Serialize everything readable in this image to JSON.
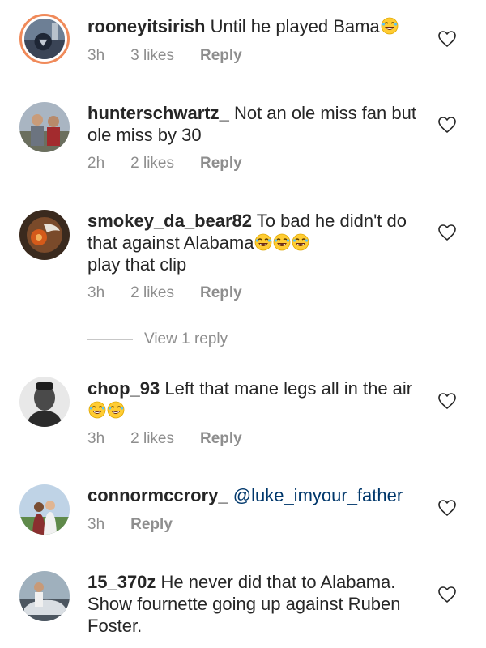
{
  "comments": [
    {
      "username": "rooneyitsirish",
      "text": "Until he played Bama",
      "emojis": [
        "laughing-emoji"
      ],
      "time": "3h",
      "likes": "3 likes",
      "reply": "Reply"
    },
    {
      "username": "hunterschwartz_",
      "text": "Not an ole miss fan but ole miss by 30",
      "time": "2h",
      "likes": "2 likes",
      "reply": "Reply"
    },
    {
      "username": "smokey_da_bear82",
      "text_before_emojis": "To bad he didn't do that against Alabama",
      "emojis": [
        "laughing-emoji",
        "laughing-emoji",
        "laughing-emoji"
      ],
      "text_after_emojis": "play that clip",
      "time": "3h",
      "likes": "2 likes",
      "reply": "Reply",
      "view_replies": "View 1 reply"
    },
    {
      "username": "chop_93",
      "text": "Left that mane legs all in the air",
      "emojis": [
        "laughing-emoji",
        "laughing-emoji"
      ],
      "time": "3h",
      "likes": "2 likes",
      "reply": "Reply"
    },
    {
      "username": "connormccrory_",
      "mention": "@luke_imyour_father",
      "time": "3h",
      "reply": "Reply"
    },
    {
      "username": "15_370z",
      "text": "He never did that to Alabama. Show fournette going up against Ruben Foster."
    }
  ],
  "icons": {
    "like": "heart-outline-icon",
    "emoji": "laughing-face"
  },
  "colors": {
    "text": "#262626",
    "meta": "#8e8e8e",
    "mention": "#00376b",
    "story_ring": "#f08a5a"
  }
}
